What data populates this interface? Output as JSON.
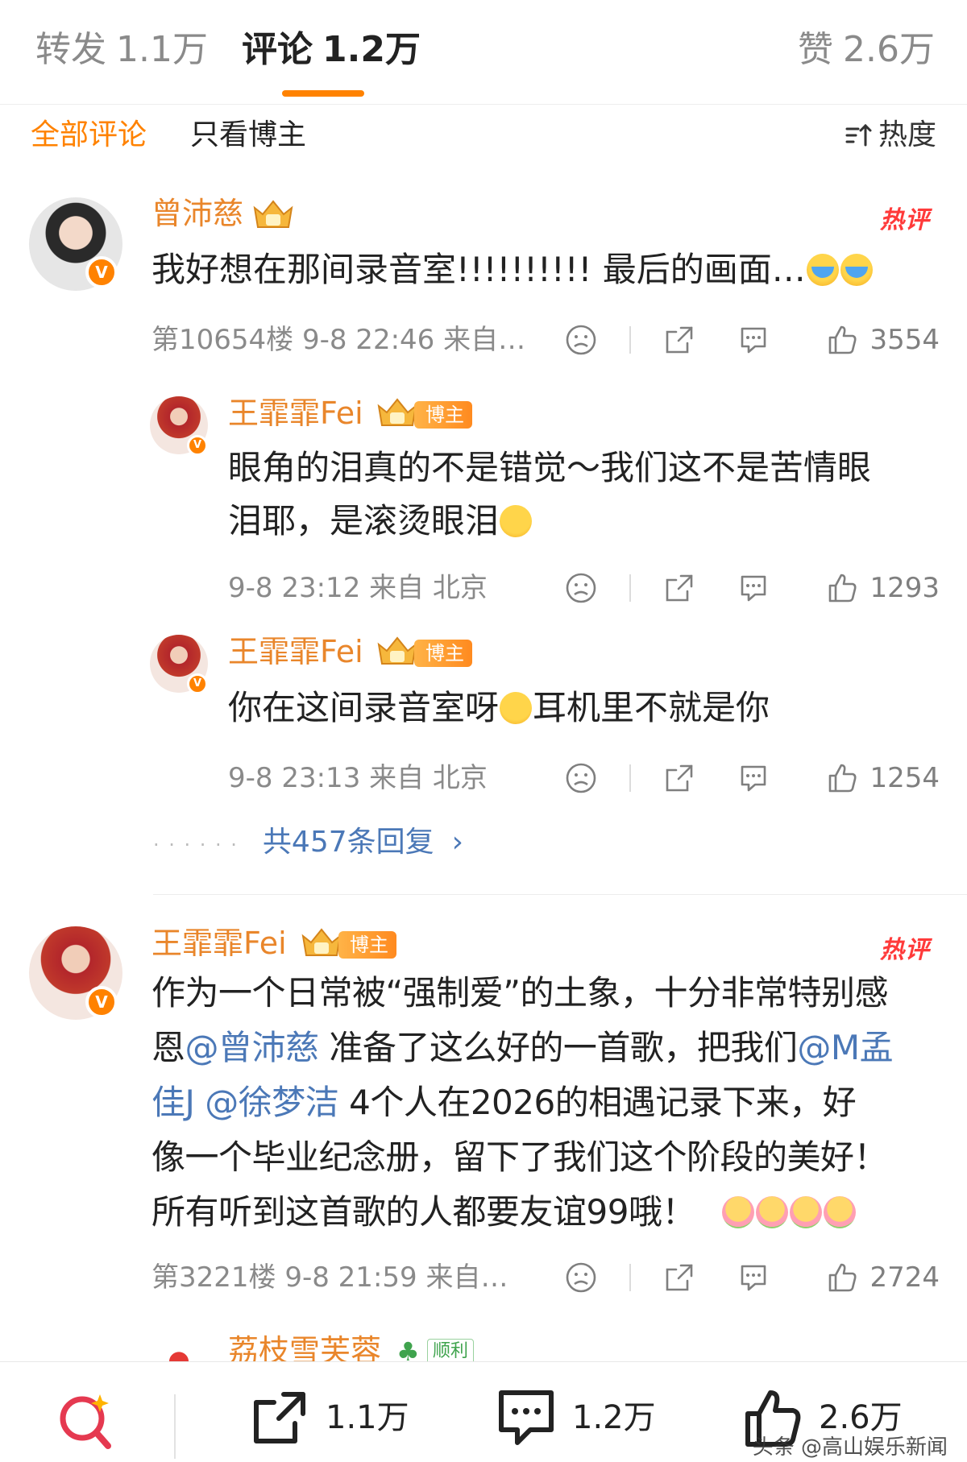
{
  "tabs": [
    {
      "label": "转发",
      "count": "1.1万",
      "active": false
    },
    {
      "label": "评论",
      "count": "1.2万",
      "active": true
    },
    {
      "label": "赞",
      "count": "2.6万",
      "active": false
    }
  ],
  "filter": {
    "all": "全部评论",
    "host_only": "只看博主",
    "sort": "热度"
  },
  "comments": [
    {
      "user": "曾沛慈",
      "hot": "热评",
      "text": "我好想在那间录音室!!!!!!!!!! 最后的画面…",
      "meta": "第10654楼 9-8 22:46 来自…",
      "likes": "3554",
      "replies": [
        {
          "user": "王霏霏Fei",
          "host_tag": "博主",
          "text_line1": "眼角的泪真的不是错觉～我们这不是苦情眼",
          "text_line2": "泪耶，是滚烫眼泪",
          "meta": "9-8 23:12  来自 北京",
          "likes": "1293"
        },
        {
          "user": "王霏霏Fei",
          "host_tag": "博主",
          "text_a": "你在这间录音室呀",
          "text_b": "耳机里不就是你",
          "meta": "9-8 23:13  来自 北京",
          "likes": "1254"
        }
      ],
      "more_replies": "共457条回复"
    },
    {
      "user": "王霏霏Fei",
      "host_tag": "博主",
      "hot": "热评",
      "line1": "作为一个日常被“强制爱”的土象，十分非常特别感",
      "line2_a": "恩",
      "mention1": "@曾沛慈",
      "line2_b": " 准备了这么好的一首歌，把我们",
      "mention2a": "@M孟",
      "mention2b": "佳J",
      "mention3": "@徐梦洁",
      "line3_b": "  4个人在2026的相遇记录下来，好",
      "line4": "像一个毕业纪念册，留下了我们这个阶段的美好！",
      "line5": "所有听到这首歌的人都要友谊99哦！",
      "meta": "第3221楼 9-8 21:59 来自…",
      "likes": "2724"
    },
    {
      "user": "荔枝雪芙蓉",
      "tag": "顺利"
    }
  ],
  "bottom": {
    "reposts": "1.1万",
    "comments": "1.2万",
    "likes": "2.6万",
    "watermark": "头条 @高山娱乐新闻"
  },
  "colors": {
    "accent": "#ff8200",
    "username": "#e9862b",
    "mention": "#4b78b7",
    "hot": "#ff3a3a"
  }
}
